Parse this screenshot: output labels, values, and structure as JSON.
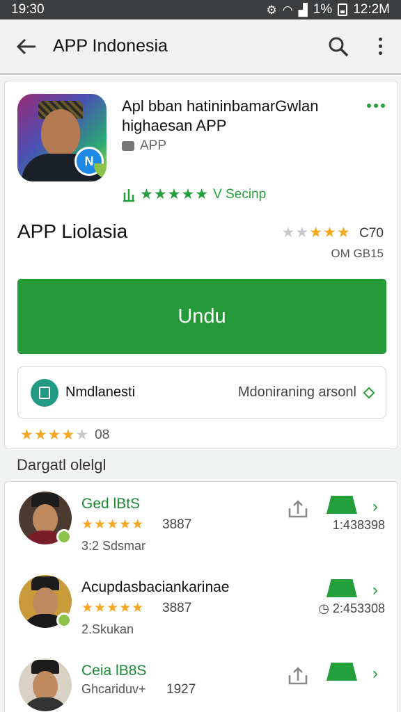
{
  "status_bar": {
    "time": "19:30",
    "battery": "1%",
    "clock": "12:2M"
  },
  "app_bar": {
    "title": "APP Indonesia"
  },
  "app": {
    "name": "Apl bban hatininbamarGwlan highaesan APP",
    "developer": "APP",
    "rating_label": "V Secinp",
    "title": "APP Liolasia",
    "rating_count": "C70",
    "download_size": "OM GB15",
    "install_label": "Undu",
    "info_left": "Nmdlanesti",
    "info_right": "Mdoniraning arsonl",
    "small_rating_value": "08"
  },
  "section": {
    "title": "Dargatl olelgl"
  },
  "list": [
    {
      "title": "Ged lBtS",
      "score": "3887",
      "subtitle": "3:2 Sdsmar",
      "meta": "1:438398",
      "title_color": "#1d8a33"
    },
    {
      "title": "Acupdasbaciankarinae",
      "score": "3887",
      "subtitle": "2.Skukan",
      "meta": "2:453308",
      "title_color": "#111111"
    },
    {
      "title": "Ceia lB8S",
      "score": "1927",
      "subtitle": "Ghcariduv+",
      "meta": "",
      "title_color": "#1d8a33"
    }
  ],
  "colors": {
    "accent_green": "#259a38",
    "star_orange": "#f5a623"
  }
}
